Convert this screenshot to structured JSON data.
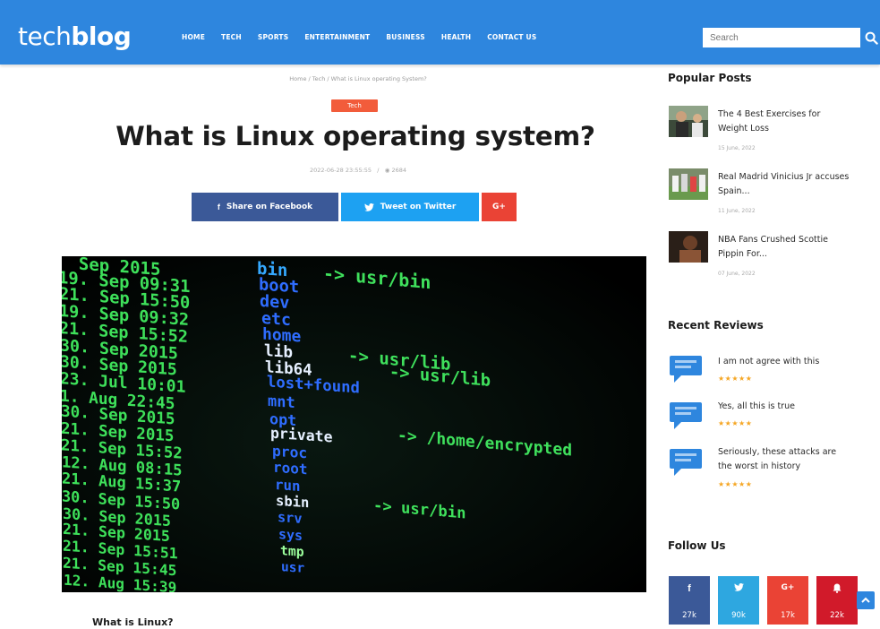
{
  "header": {
    "logo_light": "tech",
    "logo_bold": "blog",
    "nav": [
      "HOME",
      "TECH",
      "SPORTS",
      "ENTERTAINMENT",
      "BUSINESS",
      "HEALTH",
      "CONTACT US"
    ],
    "search_placeholder": "Search",
    "search_icon": "search-icon",
    "bg_color": "#2e86de"
  },
  "article": {
    "breadcrumb": "Home  /  Tech  /  What is Linux operating System?",
    "category": "Tech",
    "category_color": "#f25c3b",
    "title": "What is Linux operating system?",
    "meta_date": "2022-06-28 23:55:55",
    "meta_views": "2684",
    "share_facebook": "Share on Facebook",
    "share_twitter": "Tweet on Twitter",
    "share_gplus": "G+",
    "subheading": "What is Linux?",
    "terminal": {
      "dates": [
        "  Sep 2015",
        "19. Sep 09:31",
        "21. Sep 15:50",
        "19. Sep 09:32",
        "21. Sep 15:52",
        "30. Sep 2015",
        "30. Sep 2015",
        "23. Jul 10:01",
        "1. Aug 22:45",
        "30. Sep 2015",
        "21. Sep 2015",
        "21. Sep 15:52",
        "12. Aug 08:15",
        "21. Aug 15:37",
        "30. Sep 15:50",
        "30. Sep 2015",
        "21. Sep 2015",
        "21. Sep 15:51",
        "21. Sep 15:45",
        "12. Aug 15:39"
      ],
      "dirs": [
        "bin",
        "boot",
        "dev",
        "etc",
        "home",
        "lib",
        "lib64",
        "lost+found",
        "mnt",
        "opt",
        "private",
        "proc",
        "root",
        "run",
        "sbin",
        "srv",
        "sys",
        "tmp",
        "usr"
      ],
      "links": [
        "-> usr/bin",
        "-> usr/lib",
        "-> usr/lib",
        "-> /home/encrypted",
        "-> usr/bin"
      ]
    }
  },
  "sidebar": {
    "popular_title": "Popular Posts",
    "popular": [
      {
        "title": "The 4 Best Exercises for Weight Loss",
        "date": "15 June, 2022"
      },
      {
        "title": "Real Madrid Vinicius Jr accuses Spain...",
        "date": "11 June, 2022"
      },
      {
        "title": "NBA Fans Crushed Scottie Pippin For...",
        "date": "07 June, 2022"
      }
    ],
    "reviews_title": "Recent Reviews",
    "reviews": [
      {
        "text": "I am not agree with this",
        "stars": "★★★★★"
      },
      {
        "text": "Yes, all this is true",
        "stars": "★★★★★"
      },
      {
        "text": "Seriously, these attacks are the worst in history",
        "stars": "★★★★★"
      }
    ],
    "follow_title": "Follow Us",
    "follow": [
      {
        "icon": "f",
        "count": "27k",
        "color": "#3b5998"
      },
      {
        "icon": "t",
        "count": "90k",
        "color": "#2ea7e0"
      },
      {
        "icon": "G+",
        "count": "17k",
        "color": "#ea4335"
      },
      {
        "icon": "bell",
        "count": "22k",
        "color": "#d11a2a"
      }
    ]
  }
}
